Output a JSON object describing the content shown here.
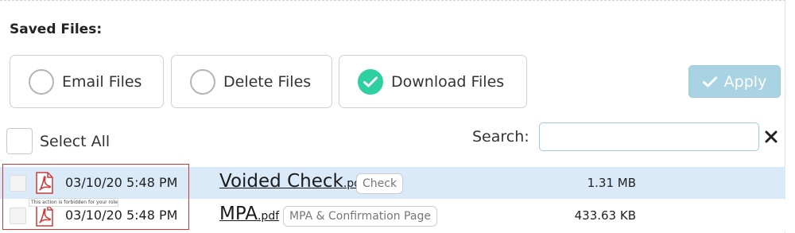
{
  "saved_files": {
    "title": "Saved Files:"
  },
  "actions": [
    {
      "label": "Email Files",
      "selected": false
    },
    {
      "label": "Delete Files",
      "selected": false
    },
    {
      "label": "Download Files",
      "selected": true
    }
  ],
  "apply_button": {
    "label": "Apply",
    "disabled": true
  },
  "select_all": {
    "label": "Select All",
    "checked": false
  },
  "search": {
    "label": "Search:",
    "value": "",
    "placeholder": ""
  },
  "files": [
    {
      "date": "03/10/20 5:48 PM",
      "name": "Voided Check",
      "ext": ".pdf",
      "tag": "Check",
      "size": "1.31 MB",
      "checked": false,
      "icon": "pdf-icon"
    },
    {
      "date": "03/10/20 5:48 PM",
      "name": "MPA",
      "ext": ".pdf",
      "tag": "MPA & Confirmation Page",
      "size": "433.63 KB",
      "checked": false,
      "icon": "pdf-icon"
    }
  ],
  "tooltip": {
    "text": "This action is forbidden for your role"
  },
  "colors": {
    "accent": "#2ecfa0",
    "apply_bg": "#a9d3e3",
    "row_highlight": "#dbeaf9",
    "annotation_border": "#e03030"
  }
}
